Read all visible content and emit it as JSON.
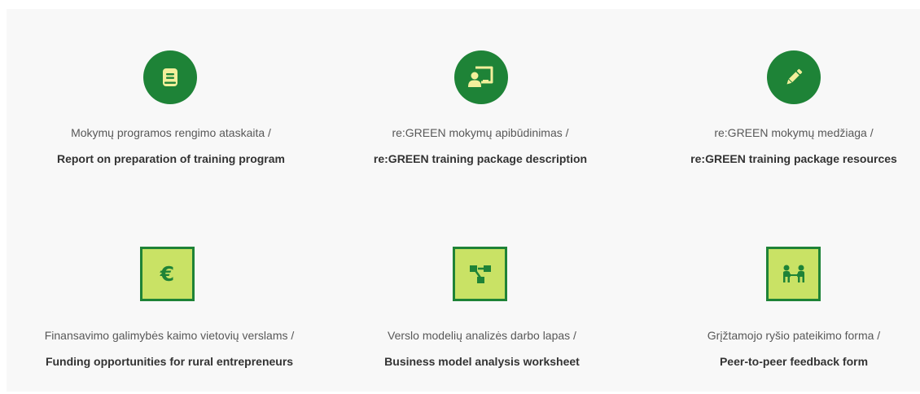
{
  "colors": {
    "accent_green": "#1e8337",
    "icon_lime": "#c9e265",
    "panel_background": "#f8f8f8"
  },
  "items": [
    {
      "icon": "book-icon",
      "shape": "circle",
      "lt": "Mokymų programos rengimo ataskaita /",
      "en": "Report on preparation of training program"
    },
    {
      "icon": "presentation-icon",
      "shape": "circle",
      "lt": "re:GREEN mokymų apibūdinimas /",
      "en": "re:GREEN training package description"
    },
    {
      "icon": "pencil-icon",
      "shape": "circle",
      "lt": "re:GREEN mokymų medžiaga /",
      "en": "re:GREEN training package resources"
    },
    {
      "icon": "euro-icon",
      "shape": "square",
      "icon_glyph": "€",
      "lt": "Finansavimo galimybės kaimo vietovių verslams /",
      "en": "Funding opportunities for rural entrepreneurs"
    },
    {
      "icon": "sitemap-icon",
      "shape": "square",
      "lt": "Verslo modelių analizės darbo lapas /",
      "en": "Business model analysis worksheet"
    },
    {
      "icon": "people-exchange-icon",
      "shape": "square",
      "lt": "Grįžtamojo ryšio pateikimo forma /",
      "en": "Peer-to-peer feedback form"
    }
  ]
}
